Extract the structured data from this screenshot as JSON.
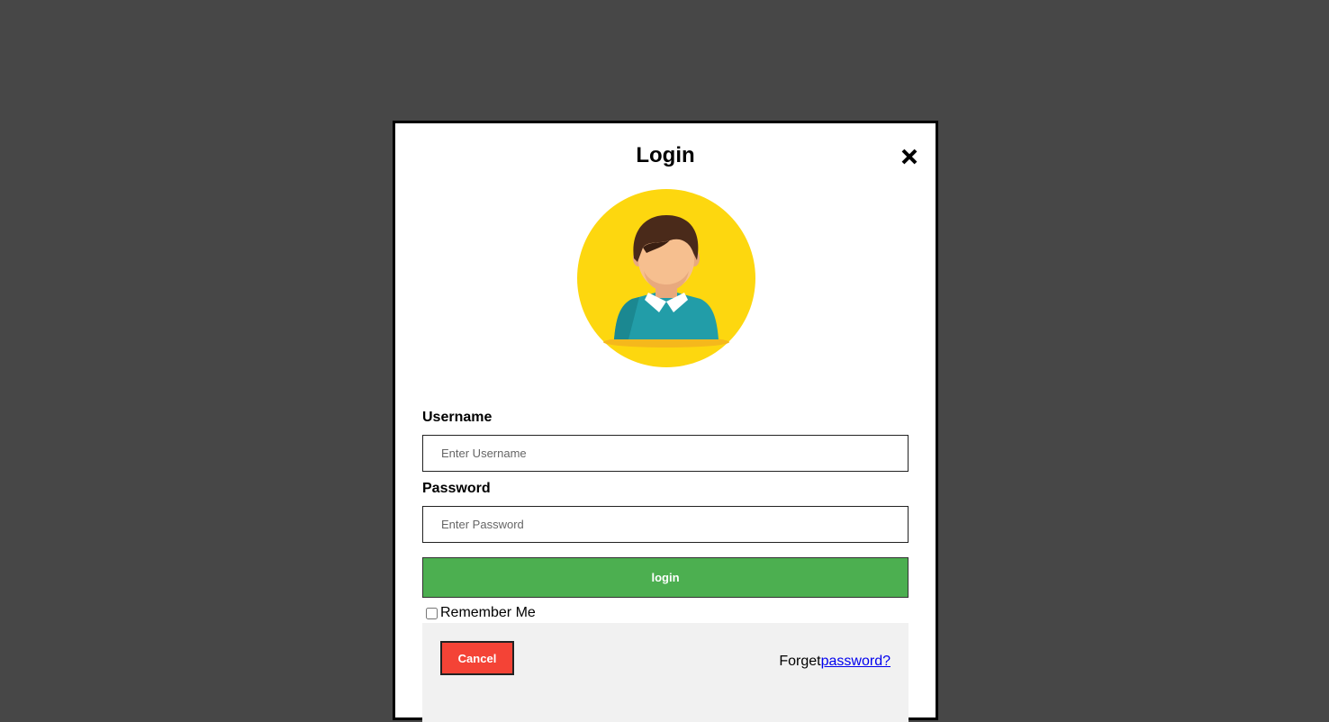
{
  "modal": {
    "title": "Login",
    "close_icon": "close-icon",
    "avatar_icon": "user-avatar-icon"
  },
  "form": {
    "username_label": "Username",
    "username_placeholder": "Enter Username",
    "password_label": "Password",
    "password_placeholder": "Enter Password",
    "login_label": "login",
    "remember_label": "Remember Me",
    "remember_checked": false
  },
  "footer": {
    "cancel_label": "Cancel",
    "forget_text": "Forget",
    "forget_link": "password?"
  },
  "colors": {
    "backdrop": "#474747",
    "login_button": "#4caf50",
    "cancel_button": "#f44336",
    "footer_bg": "#f1f1f1",
    "avatar_circle": "#fdd70f",
    "link": "#0000ee"
  }
}
